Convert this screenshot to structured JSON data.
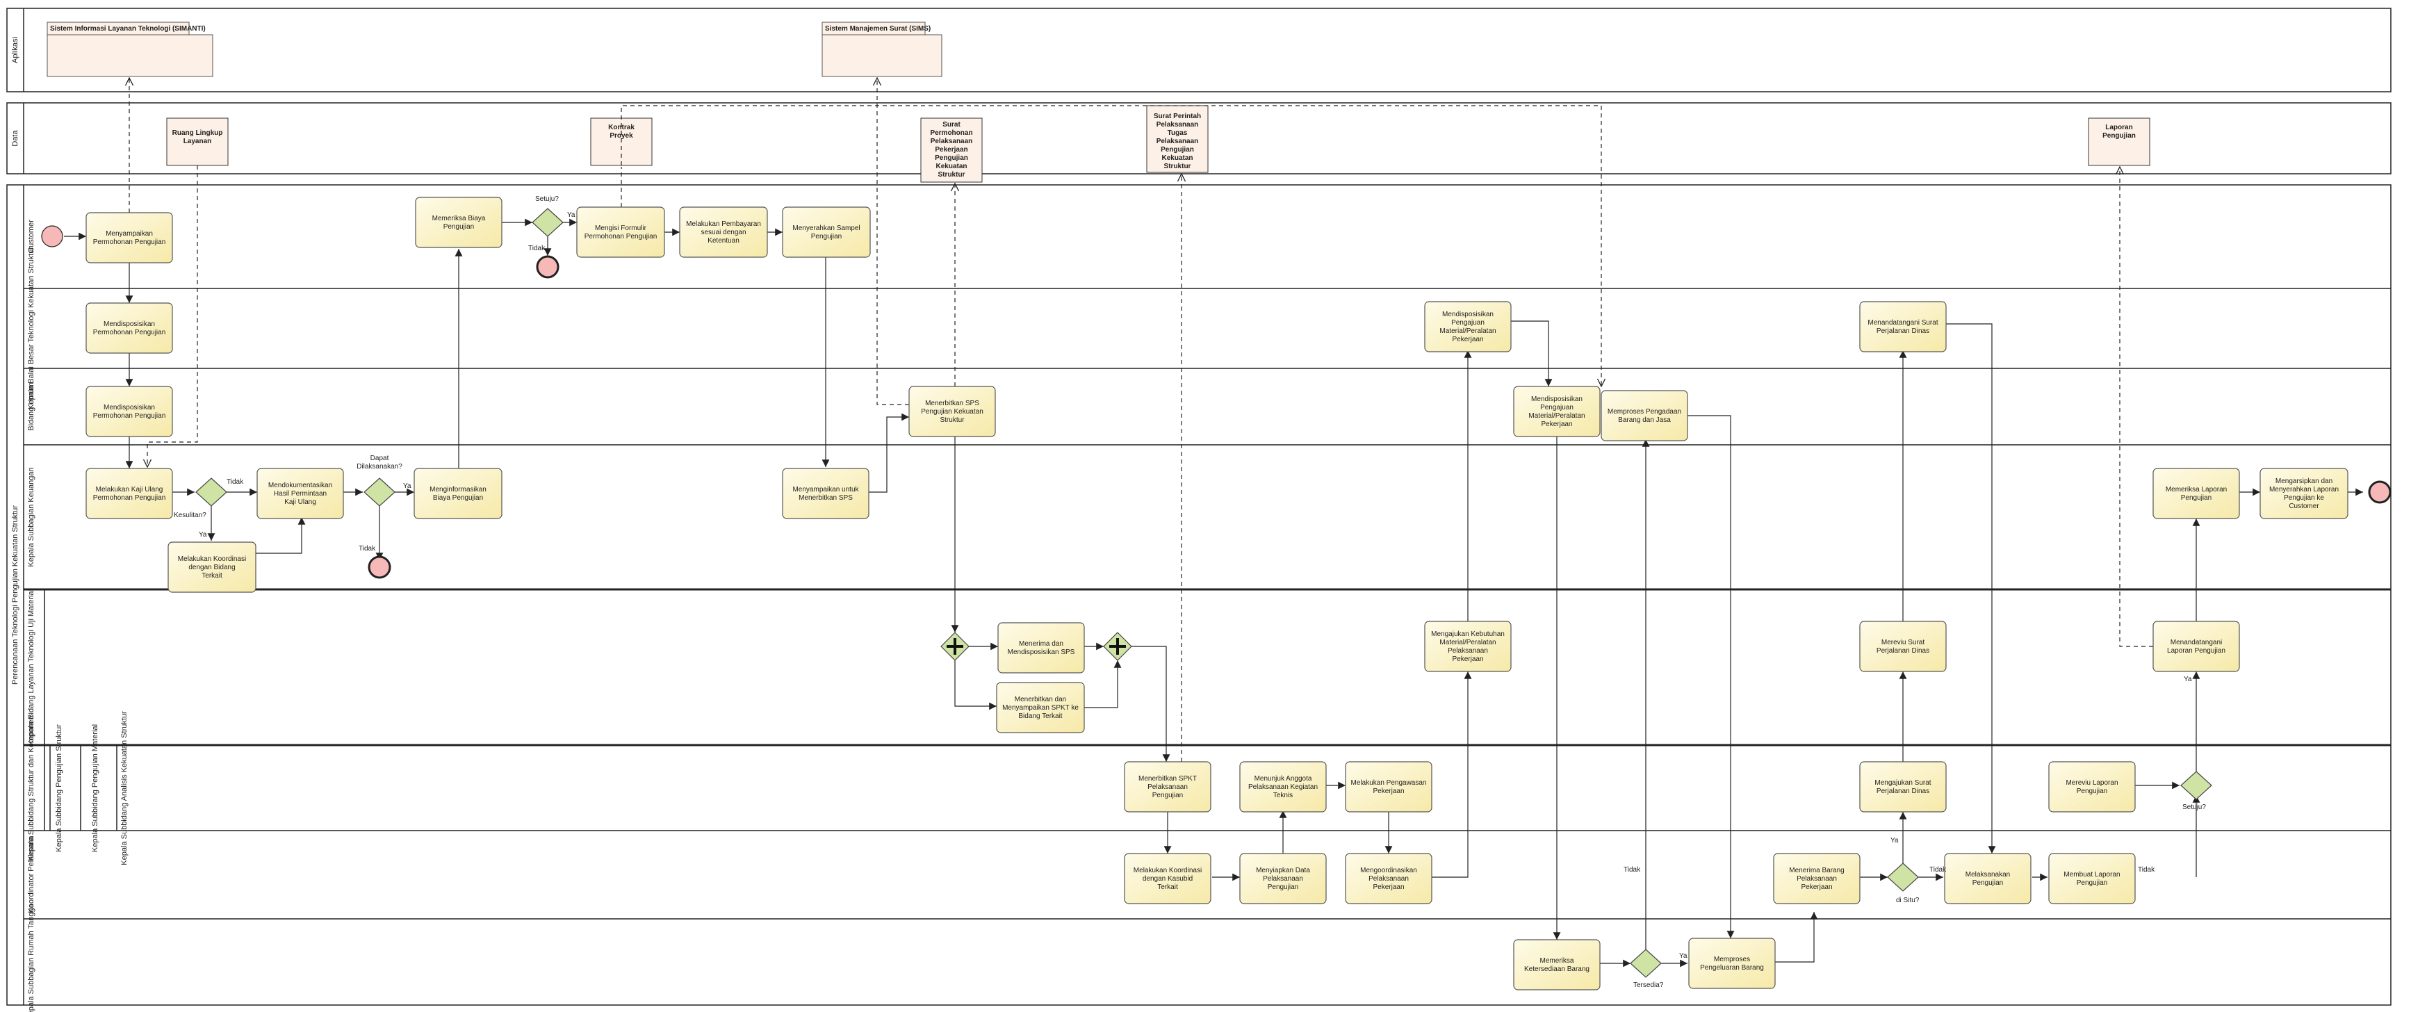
{
  "lanes": {
    "aplikasi": "Aplikasi",
    "data": "Data",
    "pool": "Perencanaan Teknologi Pengujian Kekuatan Struktur",
    "customer": "Customer",
    "kepala_balai": "Kepala Balai Besar Teknologi Kekuatan Struktur",
    "bidang_umum": "Bidang Umum",
    "kasubbag_keuangan": "Kepala Subbagian Keuangan",
    "kepala_bidang": "Kepala Bidang Layanan Teknologi Uji Material",
    "kepala_subbidang": "Kepala Subbidang Struktur dan Komponen",
    "sub1": "Kepala Subbidang Pengujian Struktur",
    "sub2": "Kepala Subbidang Pengujian Material",
    "sub3": "Kepala Subbidang Analisis Kekuatan Struktur",
    "koordinator": "Koordinator Pelaksana",
    "kasubbag_rt": "Kepala Subbagian Rumah Tangga"
  },
  "apps": {
    "simanti": "Sistem Informasi Layanan Teknologi (SIMANTI)",
    "sims": "Sistem Manajemen Surat (SIMS)"
  },
  "artifacts": {
    "ruang_lingkup": "Ruang Lingkup Layanan",
    "kontrak": "Kontrak Proyek",
    "surat_permohonan": "Surat Permohonan Pelaksanaan Pekerjaan Pengujian Kekuatan Struktur",
    "surat_perintah": "Surat Perintah Pelaksanaan Tugas Pelaksanaan Pengujian Kekuatan Struktur",
    "laporan": "Laporan Pengujian"
  },
  "tasks": {
    "t1": "Menyampaikan Permohonan Pengujian",
    "t2": "Memeriksa Biaya Pengujian",
    "t3": "Mengisi Formulir Permohonan Pengujian",
    "t4": "Melakukan Pembayaran sesuai dengan Ketentuan",
    "t5": "Menyerahkan Sampel Pengujian",
    "t6": "Mendisposisikan Permohonan Pengujian",
    "t7": "Mendisposisikan Permohonan Pengujian",
    "t8": "Melakukan Kaji Ulang Permohonan Pengujian",
    "t9": "Mendokumentasikan Hasil Permintaan Kaji Ulang",
    "t10": "Menginformasikan Biaya Pengujian",
    "t11": "Melakukan Koordinasi dengan Bidang Terkait",
    "t12": "Menyampaikan untuk Menerbitkan SPS",
    "t13": "Menerbitkan SPS Pengujian Kekuatan Struktur",
    "t14": "Menerima dan Mendisposisikan SPS",
    "t15": "Menerbitkan dan Menyampaikan SPKT ke Bidang Terkait",
    "t16": "Menerbitkan SPKT Pelaksanaan Pengujian",
    "t17": "Menunjuk Anggota Pelaksanaan Kegiatan Teknis",
    "t18": "Melakukan Pengawasan Pekerjaan",
    "t19": "Melakukan Koordinasi dengan Kasubid Terkait",
    "t20": "Menyiapkan Data Pelaksanaan Pengujian",
    "t21": "Mengoordinasikan Pelaksanaan Pekerjaan",
    "t22": "Mengajukan Kebutuhan Material/Peralatan Pelaksanaan Pekerjaan",
    "t23": "Mendisposisikan Pengajuan Material/Peralatan Pekerjaan",
    "t24": "Mendisposisikan Pengajuan Material/Peralatan Pekerjaan",
    "t25": "Memproses Pengadaan Barang dan Jasa",
    "t26": "Memeriksa Ketersediaan Barang",
    "t27": "Memproses Pengeluaran Barang",
    "t28": "Menerima Barang Pelaksanaan Pekerjaan",
    "t29": "Melaksanakan Pengujian",
    "t30": "Mengajukan Surat Perjalanan Dinas",
    "t31": "Mereviu Surat Perjalanan Dinas",
    "t32": "Menandatangani Surat Perjalanan Dinas",
    "t33": "Membuat Laporan Pengujian",
    "t34": "Mereviu Laporan Pengujian",
    "t35": "Menandatangani Laporan Pengujian",
    "t36": "Memeriksa Laporan Pengujian",
    "t37": "Mengarsipkan dan Menyerahkan Laporan Pengujian ke Customer"
  },
  "labels": {
    "setuju_q": "Setuju?",
    "ya": "Ya",
    "tidak": "Tidak",
    "kesulitan_q": "Kesulitan?",
    "dapat_q": "Dapat Dilaksanakan?",
    "tersedia_q": "Tersedia?",
    "ditsu_q": "di Situ?"
  },
  "colors": {
    "task_fill": "#fdf6c9",
    "task_stroke": "#555555",
    "artifact_fill": "#fdf0e6",
    "gateway_fill": "#cfe3a5",
    "event_fill": "#f7b8b8",
    "line": "#222222"
  }
}
